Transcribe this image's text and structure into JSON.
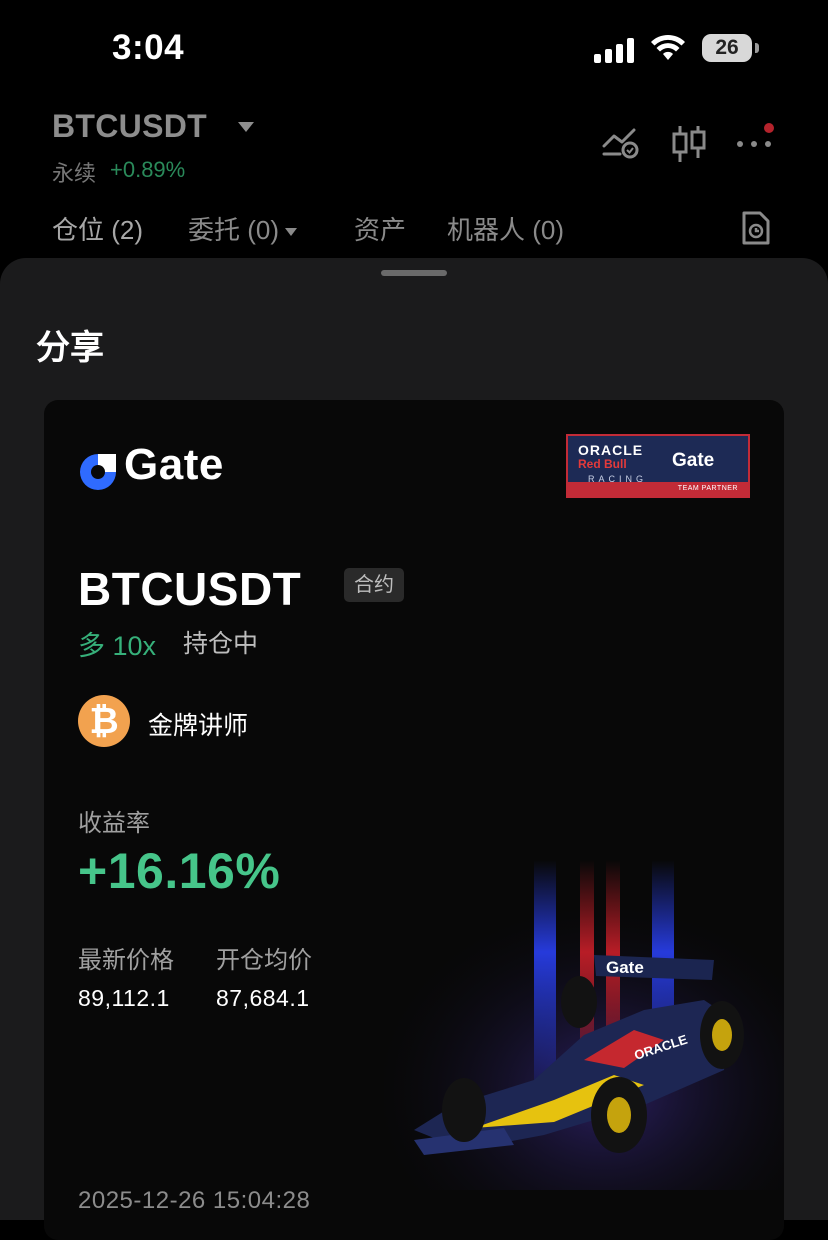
{
  "status_bar": {
    "time": "3:04",
    "battery": "26"
  },
  "header": {
    "pair": "BTCUSDT",
    "contract_type": "永续",
    "change": "+0.89%"
  },
  "tabs": [
    {
      "label": "仓位 (2)"
    },
    {
      "label": "委托 (0)"
    },
    {
      "label": "资产"
    },
    {
      "label": "机器人 (0)"
    }
  ],
  "sheet": {
    "title": "分享"
  },
  "card": {
    "brand": "Gate",
    "partner": {
      "line1": "ORACLE",
      "line2": "Red Bull",
      "line3": "RACING",
      "brand": "Gate",
      "footer": "TEAM PARTNER"
    },
    "symbol": "BTCUSDT",
    "badge": "合约",
    "direction": "多 10x",
    "status": "持仓中",
    "avatar_symbol": "₿",
    "username": "金牌讲师",
    "roi_label": "收益率",
    "roi_value": "+16.16%",
    "latest_price_label": "最新价格",
    "latest_price": "89,112.1",
    "entry_price_label": "开仓均价",
    "entry_price": "87,684.1",
    "timestamp": "2025-12-26 15:04:28"
  },
  "colors": {
    "positive": "#36b07a",
    "accent_blue": "#2f6bff",
    "avatar": "#f2a24f"
  }
}
